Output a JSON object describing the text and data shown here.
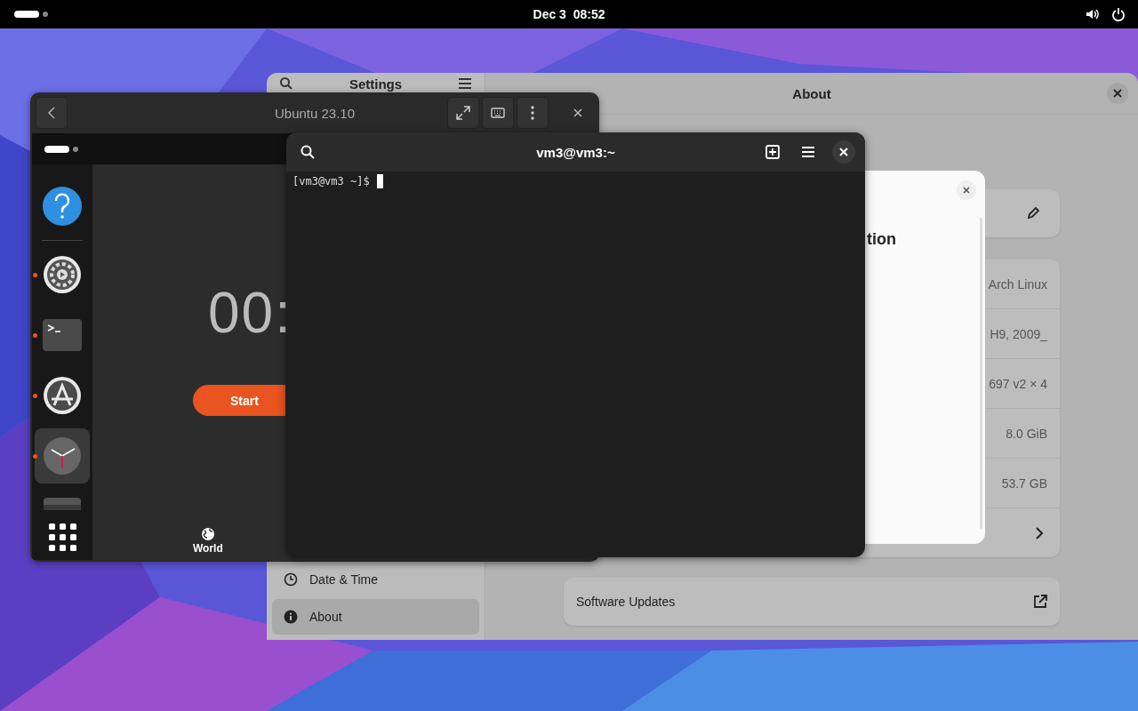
{
  "top_bar": {
    "clock": "Dec 3  08:52"
  },
  "settings": {
    "title": "Settings",
    "page_title": "About",
    "sidebar": [
      {
        "label": "Date & Time",
        "selected": false
      },
      {
        "label": "About",
        "selected": true
      }
    ],
    "rows": [
      {
        "kind": "value",
        "value": "Arch Linux"
      },
      {
        "kind": "value",
        "value": "H9, 2009_"
      },
      {
        "kind": "value",
        "value": "697 v2 × 4"
      },
      {
        "kind": "value",
        "value": "8.0 GiB"
      },
      {
        "kind": "value",
        "value": "53.7 GB"
      },
      {
        "kind": "link"
      }
    ],
    "software_updates": "Software Updates",
    "dialog": {
      "heading": "tion"
    }
  },
  "vm_window": {
    "title": "Ubuntu 23.10",
    "dock": [
      {
        "kind": "help",
        "running": false,
        "selected": false
      },
      {
        "kind": "settings",
        "running": true,
        "selected": false
      },
      {
        "kind": "terminal",
        "running": true,
        "selected": false
      },
      {
        "kind": "software",
        "running": true,
        "selected": false
      },
      {
        "kind": "clock",
        "running": true,
        "selected": true
      },
      {
        "kind": "drive",
        "running": false,
        "selected": false
      }
    ],
    "timer": "00:",
    "start": "Start",
    "tab": "World"
  },
  "terminal": {
    "title": "vm3@vm3:~",
    "prompt": "[vm3@vm3 ~]$"
  }
}
